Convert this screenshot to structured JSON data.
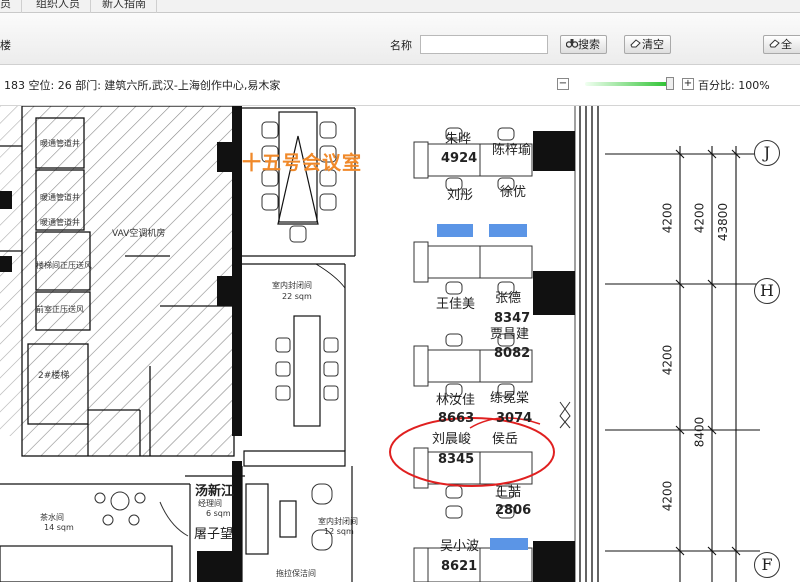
{
  "tabs": [
    "员",
    "组织人员",
    "新人指南"
  ],
  "toolbar": {
    "floor_name": "楼",
    "name_label": "名称",
    "search_value": "",
    "search_button": "搜索",
    "clear_button": "清空",
    "cut_button": "全"
  },
  "infobar": {
    "text": "183 空位: 26 部门: 建筑六所,武汉-上海创作中心,易木家",
    "zoom_label": "百分比: 100%",
    "zoom_percent": 100
  },
  "plan": {
    "conference_room_title": "十五号会议室",
    "rooms": {
      "shaft1": "暖通管道井",
      "shaft2": "暖通管道井",
      "shaft3": "暖通管道井",
      "vav": "VAV空调机房",
      "pressure": "楼梯间正压送风",
      "front_pressure": "前室正压送风",
      "stair2": "2#楼梯",
      "meeting_small": "室内封闭间",
      "meeting_small_size": "22 sqm",
      "tea": "茶水间",
      "tea_size": "14 sqm",
      "reception": "接待间",
      "reception_size": "6 sqm",
      "meeting_lower": "室内封闭间",
      "meeting_lower_size": "12 sqm",
      "mop": "拖拉保洁间"
    },
    "people": {
      "zhu": "朱晔",
      "zhu_ext": "4924",
      "chen": "陈梓瑜",
      "liu_tong": "刘彤",
      "xu": "徐优",
      "wang_jiamei": "王佳美",
      "zhang": "张德",
      "zhang_ext": "8347",
      "jia": "贾昌建",
      "jia_ext": "8082",
      "lin": "林汝佳",
      "lin_ext": "8663",
      "lian": "练冕棠",
      "lian_ext": "3074",
      "liu_chenjun": "刘晨峻",
      "liu_chenjun_ext": "8345",
      "hou": "侯岳",
      "wang_zhe": "王喆",
      "wang_zhe_ext": "2806",
      "wu": "吴小波",
      "wu_ext": "8621",
      "tang": "汤新江",
      "tang_room": "经理间",
      "tu": "屠子望"
    },
    "dimensions": {
      "d1": "4200",
      "d2": "4200",
      "d3": "43800",
      "d4": "4200",
      "d5": "8400",
      "d6": "4200"
    },
    "grid": {
      "j": "J",
      "h": "H",
      "f": "F"
    }
  }
}
